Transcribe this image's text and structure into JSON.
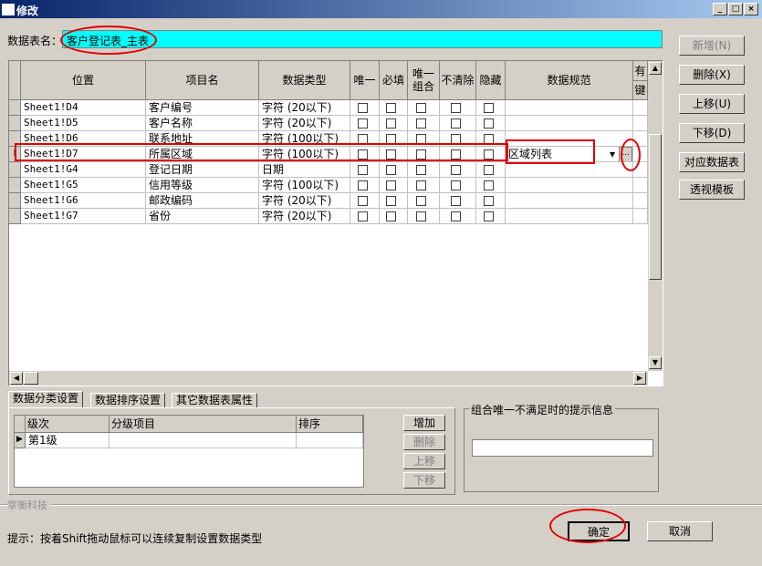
{
  "window": {
    "title": "修改",
    "min_label": "_",
    "max_label": "□",
    "close_label": "×"
  },
  "table_name": {
    "label": "数据表名：",
    "value": "客户登记表_主表"
  },
  "grid": {
    "columns": [
      "位置",
      "项目名",
      "数据类型",
      "唯一",
      "必填",
      "唯一\n组合",
      "不清除",
      "隐藏",
      "数据规范",
      "有",
      "键"
    ],
    "rows": [
      {
        "pos": "Sheet1!D4",
        "name": "客户编号",
        "type": "字符 (20以下)",
        "spec": ""
      },
      {
        "pos": "Sheet1!D5",
        "name": "客户名称",
        "type": "字符 (20以下)",
        "spec": ""
      },
      {
        "pos": "Sheet1!D6",
        "name": "联系地址",
        "type": "字符 (100以下)",
        "spec": ""
      },
      {
        "pos": "Sheet1!D7",
        "name": "所属区域",
        "type": "字符 (100以下)",
        "spec": "区域列表"
      },
      {
        "pos": "Sheet1!G4",
        "name": "登记日期",
        "type": "日期",
        "spec": ""
      },
      {
        "pos": "Sheet1!G5",
        "name": "信用等级",
        "type": "字符 (100以下)",
        "spec": ""
      },
      {
        "pos": "Sheet1!G6",
        "name": "邮政编码",
        "type": "字符 (20以下)",
        "spec": ""
      },
      {
        "pos": "Sheet1!G7",
        "name": "省份",
        "type": "字符 (20以下)",
        "spec": ""
      }
    ],
    "current_row_marker": "I",
    "ellipsis": "..."
  },
  "side_buttons": {
    "add": "新增(N)",
    "delete": "删除(X)",
    "up": "上移(U)",
    "down": "下移(D)",
    "map_table": "对应数据表",
    "pivot": "透视模板"
  },
  "tabs": [
    "数据分类设置",
    "数据排序设置",
    "其它数据表属性"
  ],
  "sub_grid": {
    "columns": [
      "级次",
      "分级项目",
      "排序"
    ],
    "rows": [
      {
        "level": "第1级",
        "item": "",
        "sort": ""
      }
    ]
  },
  "sub_buttons": {
    "add": "增加",
    "delete": "删除",
    "up": "上移",
    "down": "下移"
  },
  "combo_group": {
    "legend": "组合唯一不满足时的提示信息",
    "value": ""
  },
  "company": "宰衡科技",
  "hint": "提示：按着Shift拖动鼠标可以连续复制设置数据类型",
  "ok": "确定",
  "cancel": "取消"
}
